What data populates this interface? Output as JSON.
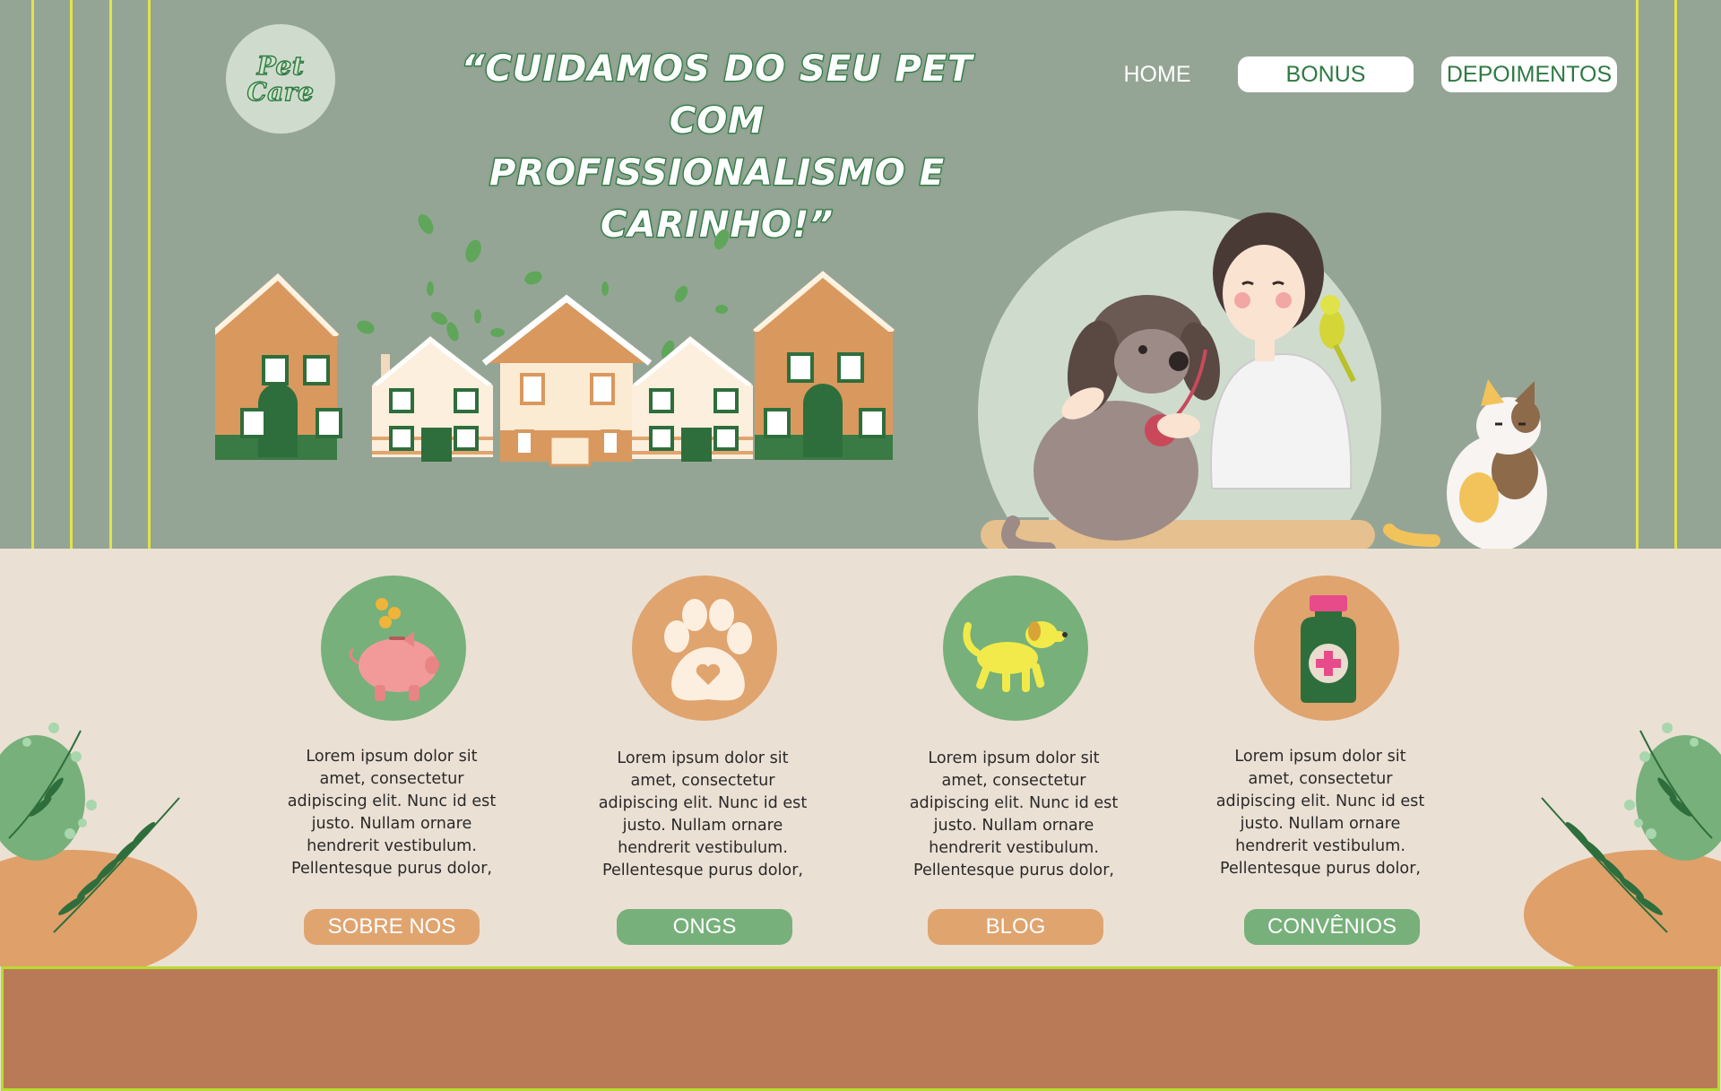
{
  "header": {
    "logo_line1": "Pet",
    "logo_line2": "Care",
    "headline_line1": "“CUIDAMOS DO SEU PET COM",
    "headline_line2": "PROFISSIONALISMO E CARINHO!”"
  },
  "nav": {
    "home": "HOME",
    "bonus": "BONUS",
    "depoimentos": "DEPOIMENTOS"
  },
  "features": [
    {
      "icon": "piggy-bank-icon",
      "lines": [
        "Lorem ipsum dolor sit",
        "amet, consectetur",
        "adipiscing elit. Nunc id est",
        "justo. Nullam ornare",
        "hendrerit vestibulum.",
        "Pellentesque purus dolor,"
      ],
      "button": "SOBRE NOS"
    },
    {
      "icon": "paw-icon",
      "lines": [
        "Lorem ipsum dolor sit",
        "amet, consectetur",
        "adipiscing elit. Nunc id est",
        "justo. Nullam ornare",
        "hendrerit vestibulum.",
        "Pellentesque purus dolor,"
      ],
      "button": "ONGS"
    },
    {
      "icon": "dog-icon",
      "lines": [
        "Lorem ipsum dolor sit",
        "amet, consectetur",
        "adipiscing elit. Nunc id est",
        "justo. Nullam ornare",
        "hendrerit vestibulum.",
        "Pellentesque purus dolor,"
      ],
      "button": "BLOG"
    },
    {
      "icon": "medicine-bottle-icon",
      "lines": [
        "Lorem ipsum dolor sit",
        "amet, consectetur",
        "adipiscing elit. Nunc id est",
        "justo. Nullam ornare",
        "hendrerit vestibulum.",
        "Pellentesque purus dolor,"
      ],
      "button": "CONVÊNIOS"
    }
  ],
  "colors": {
    "hero_bg": "#95a595",
    "cream_bg": "#ebe0d4",
    "brand_green": "#2e7a43",
    "soft_green": "#77b07a",
    "orange": "#e0a46f",
    "footer": "#b97a57",
    "footer_border": "#b6dd2e",
    "accent_yellow": "#e3e24a"
  }
}
